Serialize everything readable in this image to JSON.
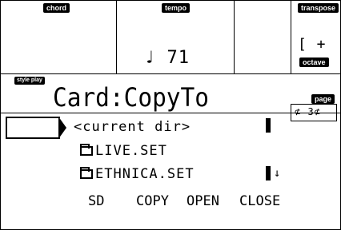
{
  "header": {
    "chord_label": "chord",
    "tempo_label": "tempo",
    "tempo_value": "♩ 71",
    "transpose_label": "transpose",
    "transpose_value": "[ +",
    "octave_label": "octave"
  },
  "mode_label": "style play",
  "title": "Card:CopyTo",
  "page": {
    "label": "page",
    "value": "⊄ 3⊄"
  },
  "list": [
    {
      "name": "<current dir>",
      "type": "parent"
    },
    {
      "name": "LIVE.SET",
      "type": "folder"
    },
    {
      "name": "ETHNICA.SET",
      "type": "folder"
    }
  ],
  "softkeys": [
    "SD",
    "COPY",
    "OPEN",
    "CLOSE"
  ]
}
